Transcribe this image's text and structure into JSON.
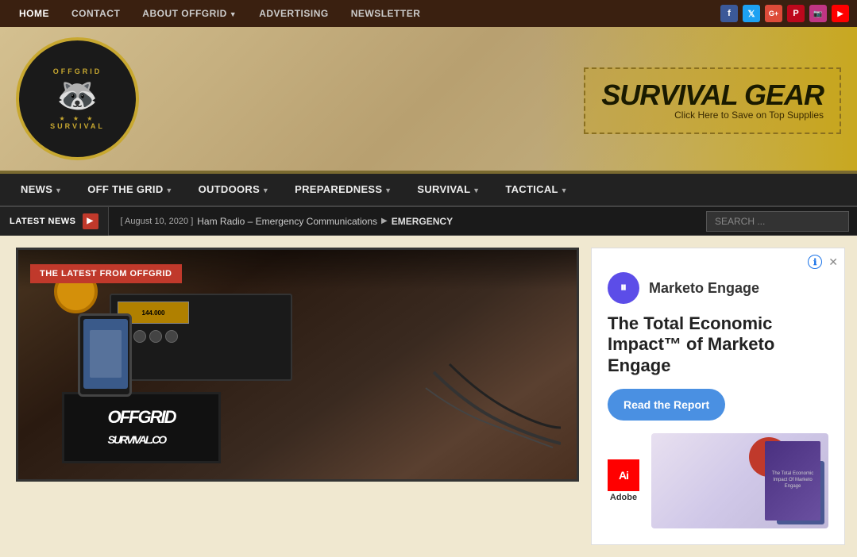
{
  "topnav": {
    "links": [
      {
        "label": "HOME",
        "active": true,
        "hasArrow": false
      },
      {
        "label": "CONTACT",
        "active": false,
        "hasArrow": false
      },
      {
        "label": "ABOUT OFFGRID",
        "active": false,
        "hasArrow": true
      },
      {
        "label": "ADVERTISING",
        "active": false,
        "hasArrow": false
      },
      {
        "label": "NEWSLETTER",
        "active": false,
        "hasArrow": false
      }
    ],
    "social": [
      {
        "icon": "f",
        "name": "facebook",
        "class": "fb"
      },
      {
        "icon": "t",
        "name": "twitter",
        "class": "tw"
      },
      {
        "icon": "g+",
        "name": "googleplus",
        "class": "gp"
      },
      {
        "icon": "p",
        "name": "pinterest",
        "class": "pi"
      },
      {
        "icon": "📷",
        "name": "instagram",
        "class": "ig"
      },
      {
        "icon": "▶",
        "name": "youtube",
        "class": "yt"
      }
    ]
  },
  "header": {
    "logo": {
      "top_text": "OFFGRID",
      "bottom_text": "SURVIVAL",
      "alt": "Offgrid Survival Logo"
    },
    "ad_banner": {
      "title": "SURVIVAL GEAR",
      "subtitle": "Click Here to Save on Top Supplies"
    }
  },
  "mainnav": {
    "items": [
      {
        "label": "NEWS",
        "hasArrow": true
      },
      {
        "label": "OFF THE GRID",
        "hasArrow": true
      },
      {
        "label": "OUTDOORS",
        "hasArrow": true
      },
      {
        "label": "PREPAREDNESS",
        "hasArrow": true
      },
      {
        "label": "SURVIVAL",
        "hasArrow": true
      },
      {
        "label": "TACTICAL",
        "hasArrow": true
      }
    ]
  },
  "latestnews": {
    "label": "LATEST NEWS",
    "article": {
      "date": "[ August 10, 2020 ]",
      "title": "Ham Radio – Emergency Communications",
      "arrow": "▶",
      "category": "EMERGENCY"
    },
    "search_placeholder": "SEARCH ..."
  },
  "featured": {
    "badge": "THE LATEST FROM OFFGRID"
  },
  "sidebar_ad": {
    "brand": "Marketo Engage",
    "headline": "The Total Economic Impact™ of Marketo Engage",
    "cta": "Read the Report",
    "logo_letter": "iii",
    "adobe_label": "Adobe",
    "book_text": "The Total Economic Impact Of Marketo Engage"
  }
}
